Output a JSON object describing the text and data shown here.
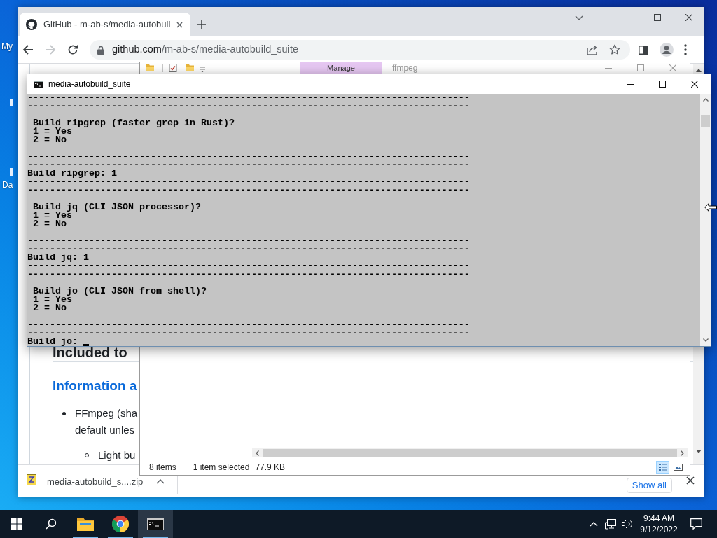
{
  "desktop": {
    "labels": [
      "My",
      "Da"
    ]
  },
  "browser": {
    "tabs": [
      {
        "title": "GitHub - m-ab-s/media-autobuil",
        "selected": true
      }
    ],
    "nav": [
      {
        "kind": "back",
        "disabled": false
      },
      {
        "kind": "forward",
        "disabled": true
      },
      {
        "kind": "reload",
        "disabled": false
      }
    ],
    "address": {
      "host": "github.com",
      "path": "/m-ab-s/media-autobuild_suite"
    },
    "page": {
      "heading": "Included to",
      "section_heading": "Information a",
      "list": [
        {
          "lines": [
            "FFmpeg (sha",
            "default unles"
          ],
          "children": [
            {
              "lines": [
                "Light bu"
              ]
            }
          ]
        }
      ]
    },
    "downloads": [
      {
        "file": "media-autobuild_s....zip"
      }
    ],
    "show_all": "Show all"
  },
  "explorer": {
    "ribbon_tab": "Manage",
    "title": "ffmpeg",
    "views": [
      {
        "kind": "details",
        "selected": true
      },
      {
        "kind": "large-icons",
        "selected": false
      }
    ],
    "status": {
      "count": "8 items",
      "selection": "1 item selected",
      "size": "77.9 KB"
    }
  },
  "console": {
    "title": "media-autobuild_suite",
    "lines": [
      {
        "kind": "rule",
        "text": "-------------------------------------------------------------------------------"
      },
      {
        "kind": "rule",
        "text": "-------------------------------------------------------------------------------"
      },
      {
        "kind": "question",
        "text": "Build ripgrep (faster grep in Rust)?"
      },
      {
        "kind": "option",
        "text": "1 = Yes"
      },
      {
        "kind": "option",
        "text": "2 = No"
      },
      {
        "kind": "rule",
        "text": "-------------------------------------------------------------------------------"
      },
      {
        "kind": "rule",
        "text": "-------------------------------------------------------------------------------"
      },
      {
        "kind": "answer",
        "text": "Build ripgrep: 1"
      },
      {
        "kind": "rule",
        "text": "-------------------------------------------------------------------------------"
      },
      {
        "kind": "rule",
        "text": "-------------------------------------------------------------------------------"
      },
      {
        "kind": "question",
        "text": "Build jq (CLI JSON processor)?"
      },
      {
        "kind": "option",
        "text": "1 = Yes"
      },
      {
        "kind": "option",
        "text": "2 = No"
      },
      {
        "kind": "rule",
        "text": "-------------------------------------------------------------------------------"
      },
      {
        "kind": "rule",
        "text": "-------------------------------------------------------------------------------"
      },
      {
        "kind": "answer",
        "text": "Build jq: 1"
      },
      {
        "kind": "rule",
        "text": "-------------------------------------------------------------------------------"
      },
      {
        "kind": "rule",
        "text": "-------------------------------------------------------------------------------"
      },
      {
        "kind": "question",
        "text": "Build jo (CLI JSON from shell)?"
      },
      {
        "kind": "option",
        "text": "1 = Yes"
      },
      {
        "kind": "option",
        "text": "2 = No"
      },
      {
        "kind": "rule",
        "text": "-------------------------------------------------------------------------------"
      },
      {
        "kind": "rule",
        "text": "-------------------------------------------------------------------------------"
      },
      {
        "kind": "input",
        "text": "Build jo:"
      }
    ]
  },
  "taskbar": {
    "apps": [
      {
        "kind": "explorer",
        "running": true,
        "selected": false
      },
      {
        "kind": "browser",
        "running": true,
        "selected": false
      },
      {
        "kind": "console",
        "running": true,
        "selected": true
      }
    ],
    "time": "9:44 AM",
    "date": "9/12/2022"
  }
}
